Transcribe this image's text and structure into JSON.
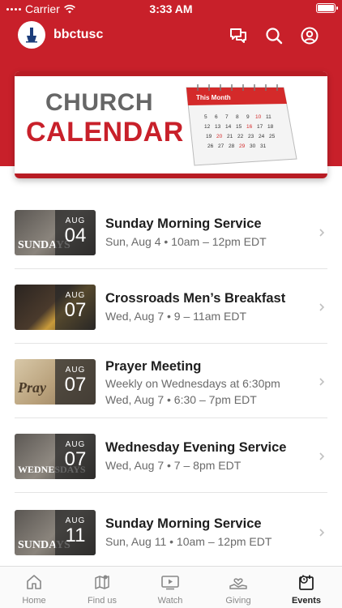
{
  "status": {
    "carrier": "Carrier",
    "time": "3:33 AM"
  },
  "app": {
    "name": "bbctusc"
  },
  "banner": {
    "line1": "CHURCH",
    "line2": "CALENDAR",
    "cal_header": "This Month"
  },
  "events": [
    {
      "month": "AUG",
      "day": "04",
      "title": "Sunday Morning Service",
      "sub1": "Sun, Aug 4 • 10am – 12pm EDT",
      "sub2": "",
      "thumb_word": "SUNDAYS"
    },
    {
      "month": "AUG",
      "day": "07",
      "title": "Crossroads Men’s Breakfast",
      "sub1": "Wed, Aug 7 • 9 – 11am EDT",
      "sub2": "",
      "thumb_word": ""
    },
    {
      "month": "AUG",
      "day": "07",
      "title": "Prayer Meeting",
      "sub1": "Weekly on Wednesdays at 6:30pm",
      "sub2": "Wed, Aug 7 • 6:30 – 7pm EDT",
      "thumb_word": "Pray"
    },
    {
      "month": "AUG",
      "day": "07",
      "title": "Wednesday Evening Service",
      "sub1": "Wed, Aug 7 • 7 – 8pm EDT",
      "sub2": "",
      "thumb_word": "WEDNESDAYS"
    },
    {
      "month": "AUG",
      "day": "11",
      "title": "Sunday Morning Service",
      "sub1": "Sun, Aug 11 • 10am – 12pm EDT",
      "sub2": "",
      "thumb_word": "SUNDAYS"
    }
  ],
  "tabs": [
    {
      "label": "Home",
      "icon": "home-icon"
    },
    {
      "label": "Find us",
      "icon": "map-icon"
    },
    {
      "label": "Watch",
      "icon": "play-icon"
    },
    {
      "label": "Giving",
      "icon": "giving-icon"
    },
    {
      "label": "Events",
      "icon": "calendar-icon",
      "active": true
    }
  ],
  "colors": {
    "brand": "#c8202a",
    "text": "#1e1e1e",
    "muted": "#6a6a6a"
  }
}
